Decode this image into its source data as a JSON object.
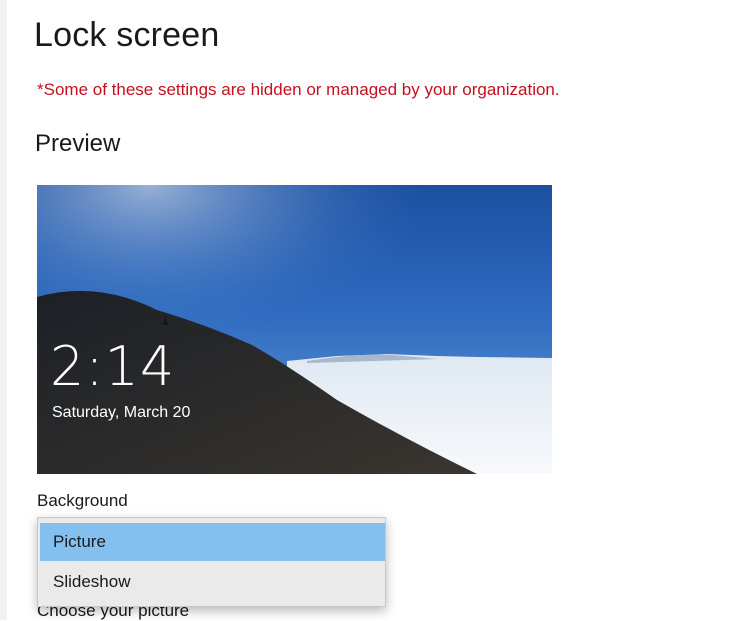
{
  "page": {
    "title": "Lock screen",
    "managed_note": "*Some of these settings are hidden or managed by your organization."
  },
  "preview": {
    "section_title": "Preview",
    "time": "2:14",
    "date": "Saturday, March 20"
  },
  "background": {
    "label": "Background",
    "selected": "Picture",
    "options": [
      {
        "label": "Picture",
        "selected": true
      },
      {
        "label": "Slideshow",
        "selected": false
      }
    ],
    "highlight_color": "#84c0ef"
  },
  "choose_picture": {
    "label": "Choose your picture"
  },
  "colors": {
    "warning": "#c50f1f"
  }
}
